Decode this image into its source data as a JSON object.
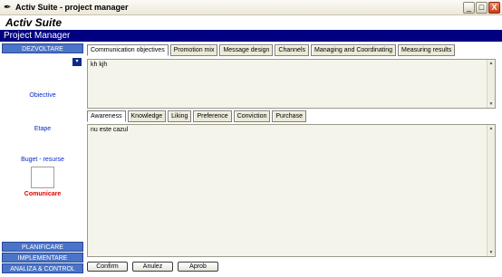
{
  "window": {
    "title": "Activ Suite - project manager",
    "app_icon": "feather-icon",
    "controls": {
      "minimize": "_",
      "maximize": "□",
      "close": "X"
    }
  },
  "app": {
    "brand": "Activ Suite",
    "section_title": "Project Manager"
  },
  "sidebar": {
    "sections": {
      "dezvoltare": "DEZVOLTARE",
      "planificare": "PLANIFICARE",
      "implementare": "IMPLEMENTARE",
      "analiza": "ANALIZA & CONTROL"
    },
    "scroll_button": "▾",
    "items": {
      "obiective": "Obiective",
      "etape": "Etape",
      "buget": "Buget - resurse",
      "comunicare": "Comunicare"
    }
  },
  "main": {
    "tabs": [
      "Communication objectives",
      "Promotion mix",
      "Message design",
      "Channels",
      "Managing and Coordinating",
      "Measuring results"
    ],
    "top_text": "kh kjh",
    "sub_tabs": [
      "Awareness",
      "Knowledge",
      "Liking",
      "Preference",
      "Conviction",
      "Purchase"
    ],
    "bottom_text": "nu este cazul",
    "buttons": {
      "confirm": "Confirm",
      "anulez": "Anulez",
      "aprob": "Aprob"
    }
  },
  "colors": {
    "header_navy": "#000080",
    "sidebar_blue": "#4a74c8",
    "link_blue": "#0a2ac8",
    "active_red": "#e00000"
  }
}
